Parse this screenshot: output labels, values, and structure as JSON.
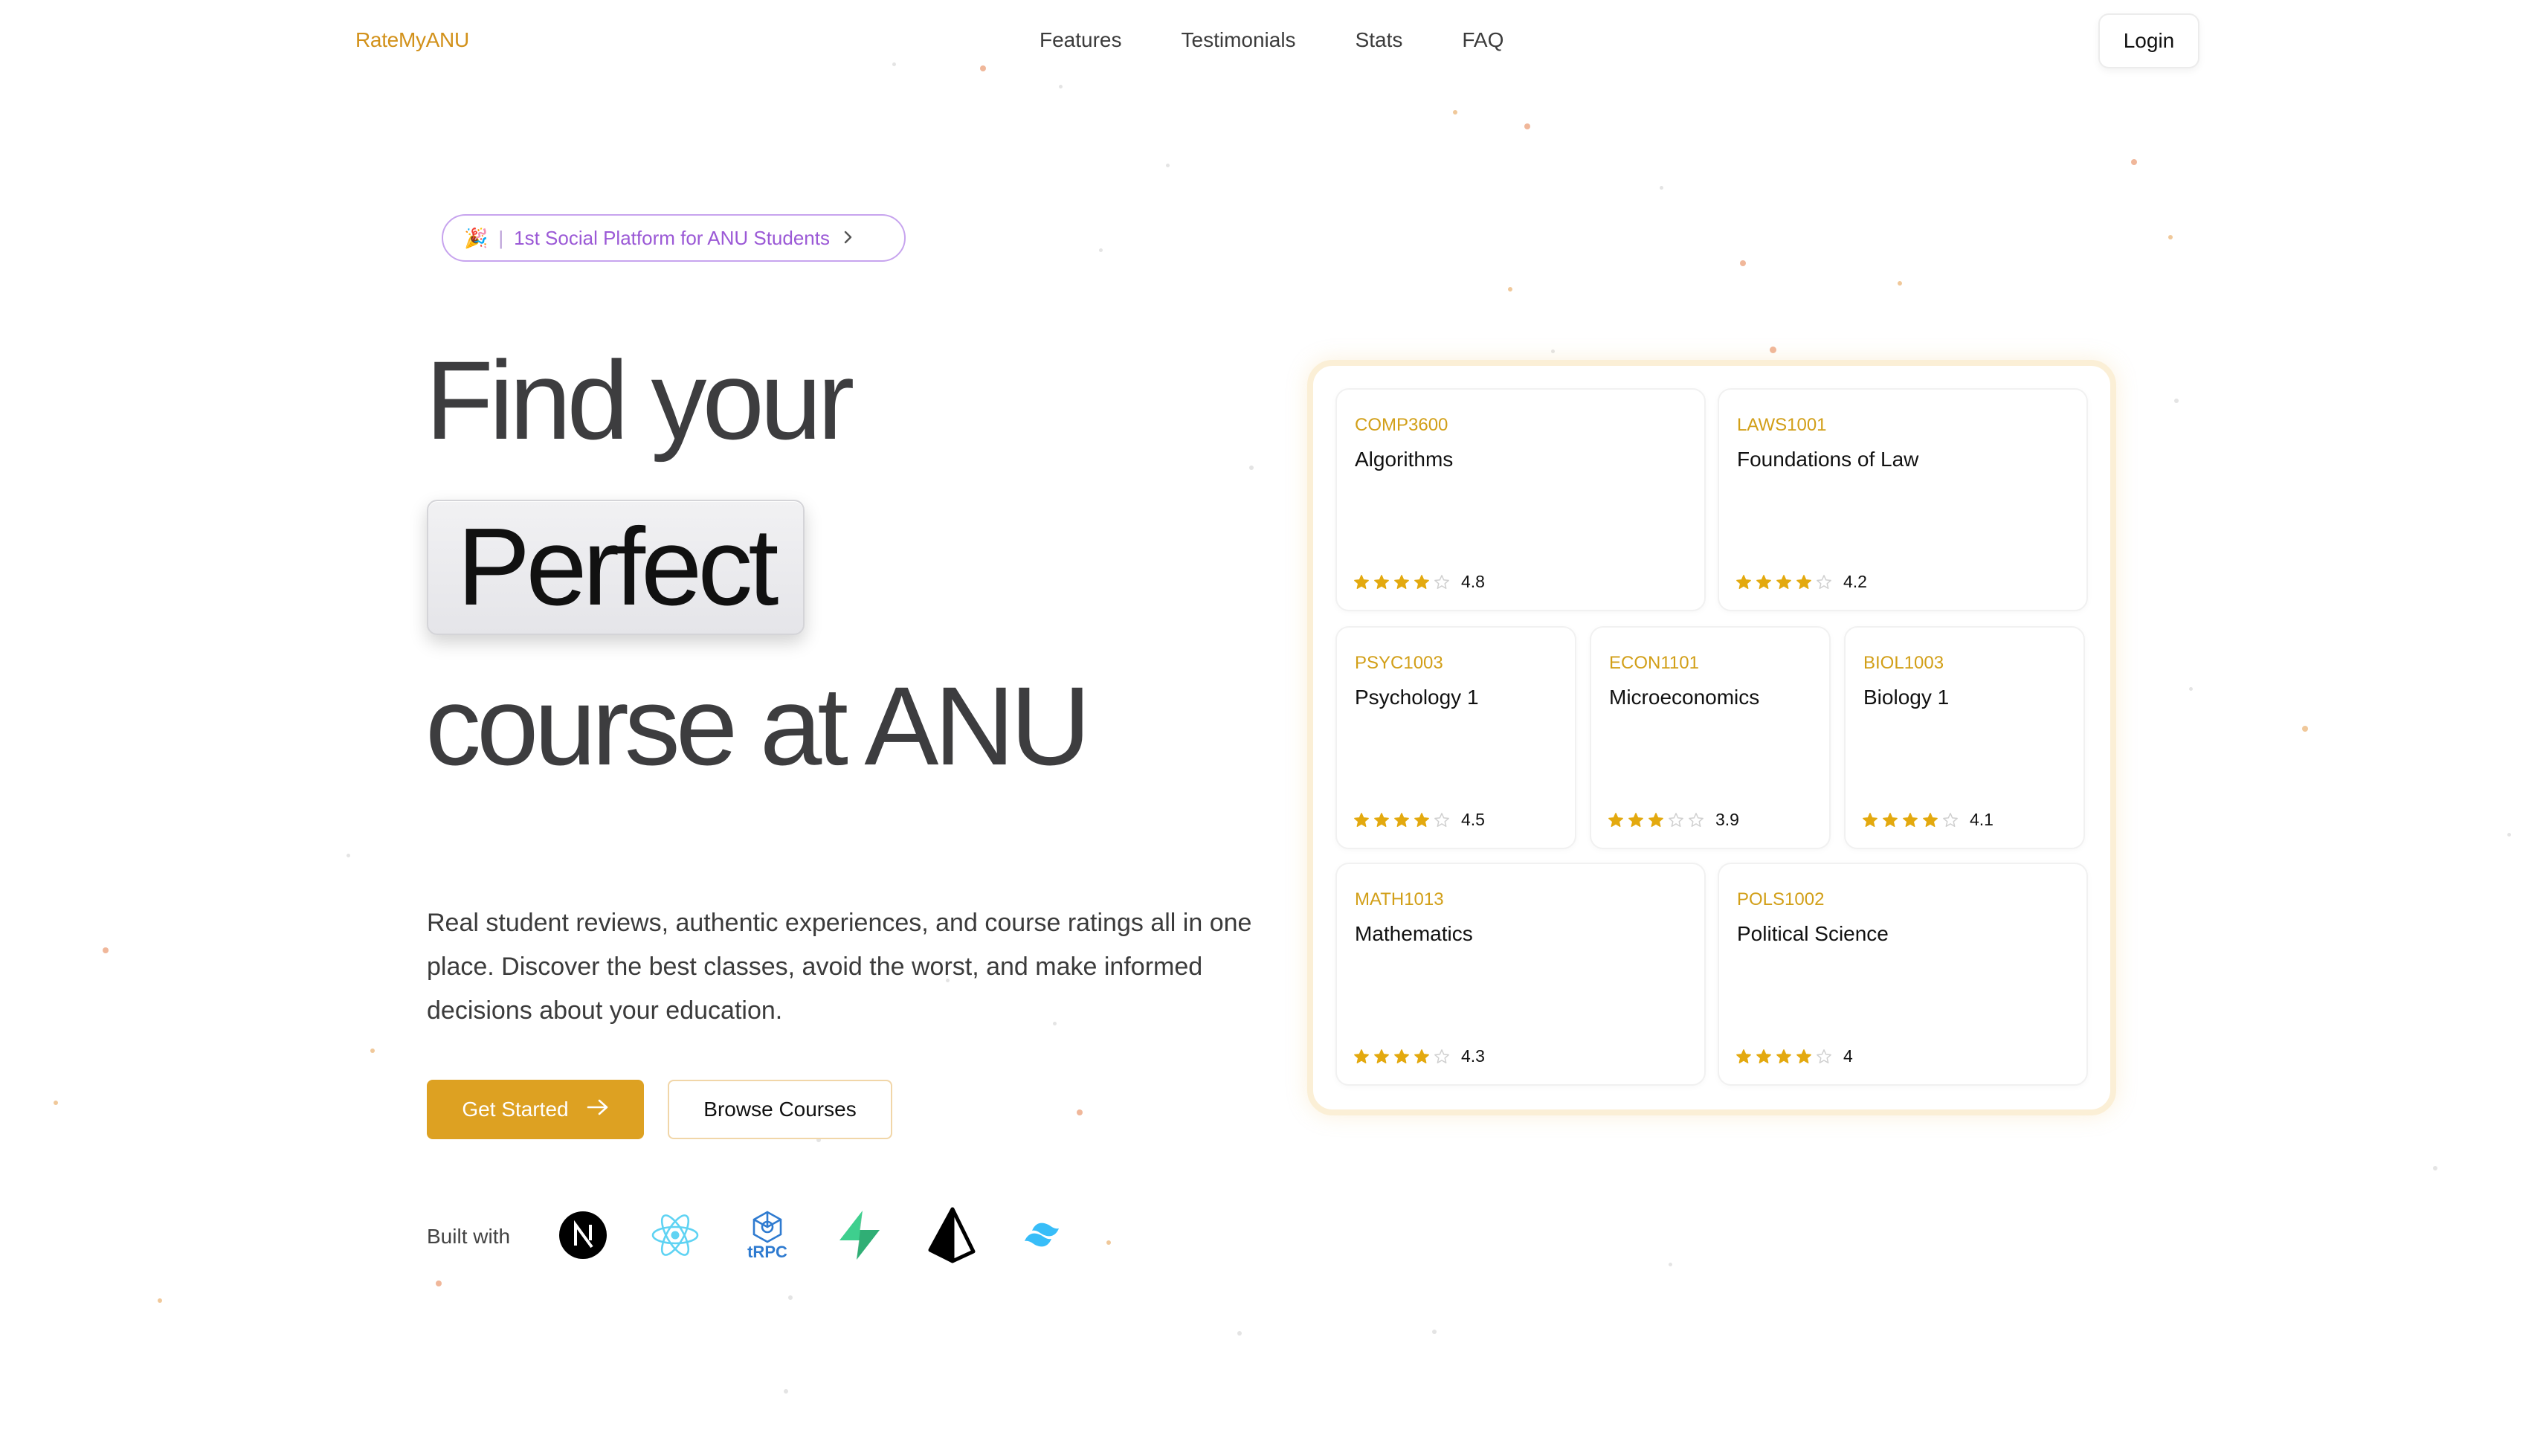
{
  "brand": {
    "name": "RateMyANU"
  },
  "nav": {
    "items": [
      "Features",
      "Testimonials",
      "Stats",
      "FAQ"
    ],
    "login": "Login"
  },
  "badge": {
    "text": "1st Social Platform for ANU Students"
  },
  "hero": {
    "line1": "Find your",
    "highlight": "Perfect",
    "line3": "course at ANU",
    "description": "Real student reviews, authentic experiences, and course ratings all in one place. Discover the best classes, avoid the worst, and make informed decisions about your education.",
    "cta_primary": "Get Started",
    "cta_secondary": "Browse Courses"
  },
  "built_with": {
    "label": "Built with",
    "tech": [
      "nextjs-icon",
      "react-icon",
      "trpc-icon",
      "supabase-icon",
      "prisma-icon",
      "tailwind-icon"
    ],
    "trpc_text": "tRPC"
  },
  "courses": [
    {
      "code": "COMP3600",
      "name": "Algorithms",
      "stars": 4,
      "rating": "4.8"
    },
    {
      "code": "LAWS1001",
      "name": "Foundations of Law",
      "stars": 4,
      "rating": "4.2"
    },
    {
      "code": "PSYC1003",
      "name": "Psychology 1",
      "stars": 4,
      "rating": "4.5"
    },
    {
      "code": "ECON1101",
      "name": "Microeconomics",
      "stars": 3,
      "rating": "3.9"
    },
    {
      "code": "BIOL1003",
      "name": "Biology 1",
      "stars": 4,
      "rating": "4.1"
    },
    {
      "code": "MATH1013",
      "name": "Mathematics",
      "stars": 4,
      "rating": "4.3"
    },
    {
      "code": "POLS1002",
      "name": "Political Science",
      "stars": 4,
      "rating": "4"
    }
  ],
  "colors": {
    "accent": "#dda122",
    "code_color": "#d29f18",
    "badge_text": "#9b59d6",
    "star": "#e3a90f"
  }
}
